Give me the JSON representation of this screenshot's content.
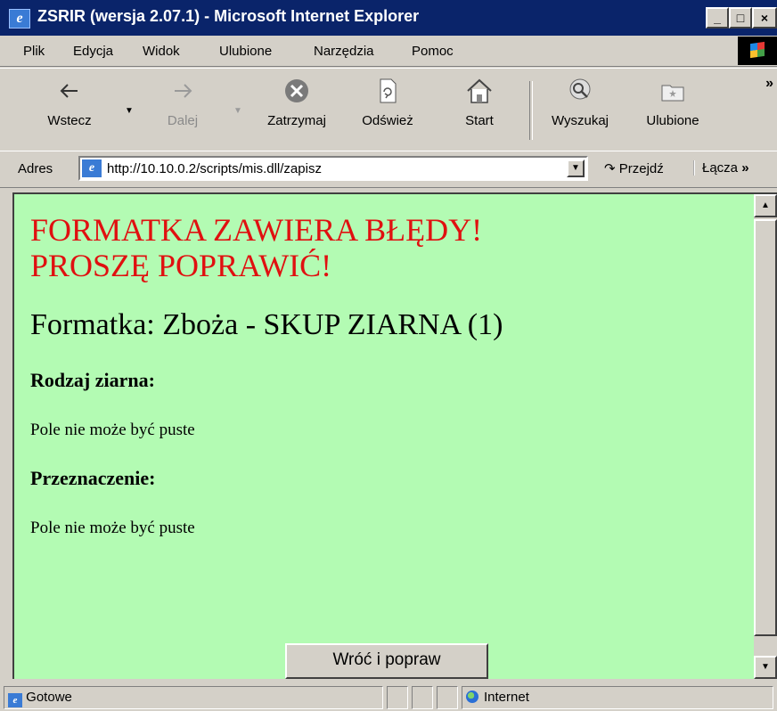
{
  "window": {
    "title": "ZSRIR (wersja 2.07.1) - Microsoft Internet Explorer"
  },
  "menu": [
    "Plik",
    "Edycja",
    "Widok",
    "Ulubione",
    "Narzędzia",
    "Pomoc"
  ],
  "toolbar": {
    "back": "Wstecz",
    "forward": "Dalej",
    "stop": "Zatrzymaj",
    "refresh": "Odśwież",
    "home": "Start",
    "search": "Wyszukaj",
    "favorites": "Ulubione"
  },
  "address": {
    "label": "Adres",
    "url": "http://10.10.0.2/scripts/mis.dll/zapisz",
    "go": "Przejdź",
    "links": "Łącza"
  },
  "page": {
    "error_line1": "FORMATKA ZAWIERA BŁĘDY!",
    "error_line2": "PROSZĘ POPRAWIĆ!",
    "form_title": "Formatka: Zboża - SKUP ZIARNA (1)",
    "fields": [
      {
        "label": "Rodzaj ziarna:",
        "message": "Pole nie może być puste"
      },
      {
        "label": "Przeznaczenie:",
        "message": "Pole nie może być puste"
      }
    ],
    "back_button": "Wróć i popraw"
  },
  "status": {
    "text": "Gotowe",
    "zone": "Internet"
  }
}
